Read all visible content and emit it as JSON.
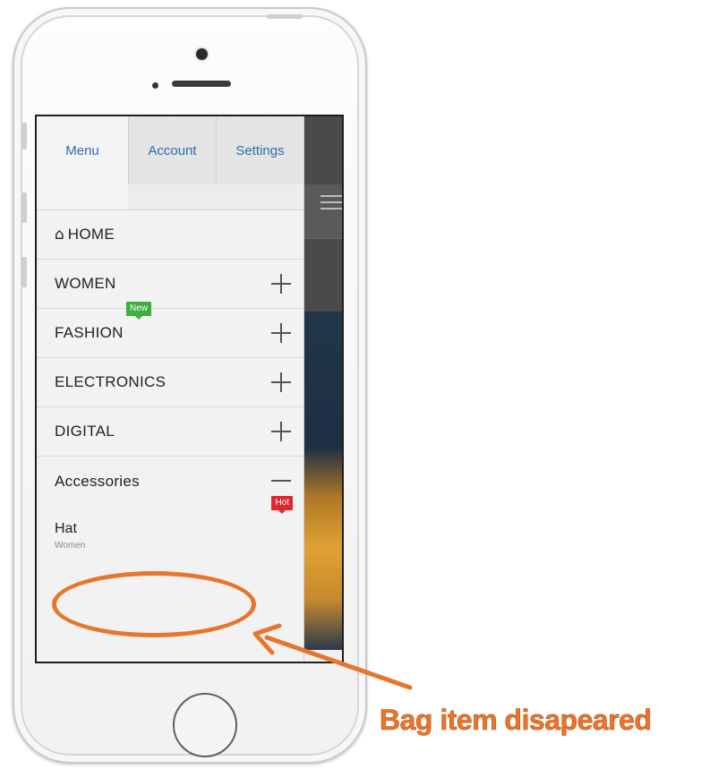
{
  "drawer": {
    "tabs": [
      {
        "label": "Menu",
        "active": true
      },
      {
        "label": "Account",
        "active": false
      },
      {
        "label": "Settings",
        "active": false
      }
    ],
    "items": [
      {
        "label": "HOME",
        "icon": "home-icon",
        "expandable": false
      },
      {
        "label": "WOMEN",
        "expandable": true
      },
      {
        "label": "FASHION",
        "expandable": true,
        "badge": "New"
      },
      {
        "label": "ELECTRONICS",
        "expandable": true
      },
      {
        "label": "DIGITAL",
        "expandable": true
      },
      {
        "label": "Accessories",
        "expandable": true,
        "expanded": true,
        "badge": "Hot"
      }
    ],
    "sub_item": {
      "title": "Hat",
      "caption": "Women"
    }
  },
  "annotation": {
    "text": "Bag item disapeared",
    "color": "#e8752c"
  },
  "colors": {
    "tab_text": "#2b6cb0",
    "badge_new": "#3db03d",
    "badge_hot": "#e0282f"
  }
}
